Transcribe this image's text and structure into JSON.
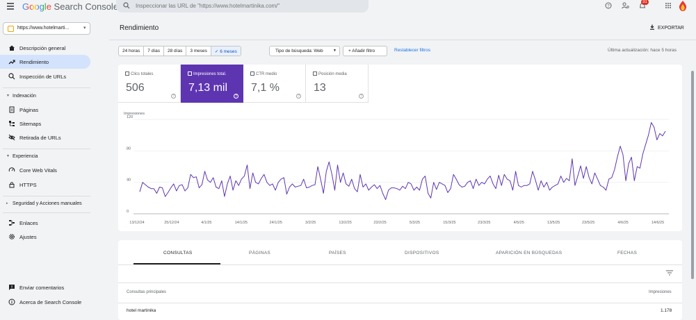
{
  "header": {
    "logo_google": "Google",
    "logo_product": "Search Console",
    "search_placeholder": "Inspeccionar las URL de \"https://www.hotelmartinika.com/\"",
    "notification_count": "31"
  },
  "sidebar": {
    "property": "https://www.hotelmarti...",
    "items": [
      {
        "label": "Descripción general",
        "icon": "home-icon"
      },
      {
        "label": "Rendimiento",
        "icon": "trending-up-icon"
      },
      {
        "label": "Inspección de URLs",
        "icon": "search-icon"
      }
    ],
    "sections": [
      {
        "label": "Indexación",
        "items": [
          {
            "label": "Páginas",
            "icon": "pages-icon"
          },
          {
            "label": "Sitemaps",
            "icon": "sitemap-icon"
          },
          {
            "label": "Retirada de URLs",
            "icon": "eye-off-icon"
          }
        ]
      },
      {
        "label": "Experiencia",
        "items": [
          {
            "label": "Core Web Vitals",
            "icon": "gauge-icon"
          },
          {
            "label": "HTTPS",
            "icon": "lock-icon"
          }
        ]
      },
      {
        "label": "Seguridad y Acciones manuales",
        "items": []
      }
    ],
    "links": [
      "Enlaces",
      "Ajustes"
    ],
    "footer": [
      "Enviar comentarios",
      "Acerca de Search Console"
    ]
  },
  "main": {
    "title": "Rendimiento",
    "export_label": "EXPORTAR",
    "date_ranges": [
      "24 horas",
      "7 días",
      "28 días",
      "3 meses",
      "6 meses"
    ],
    "selected_range": "6 meses",
    "search_type": "Tipo de búsqueda: Web",
    "add_filter": "Añadir filtro",
    "reset_filters": "Restablecer filtros",
    "last_update": "Última actualización: hace 5 horas"
  },
  "metrics": [
    {
      "label": "Clics totales",
      "value": "506",
      "selected": false
    },
    {
      "label": "Impresiones total.",
      "value": "7,13 mil",
      "selected": true
    },
    {
      "label": "CTR medio",
      "value": "7,1 %",
      "selected": false
    },
    {
      "label": "Posición media",
      "value": "13",
      "selected": false
    }
  ],
  "chart_data": {
    "type": "line",
    "title": "",
    "ylabel": "Impresiones",
    "xlabel": "",
    "ylim": [
      0,
      120
    ],
    "yticks": [
      0,
      40,
      80,
      120
    ],
    "xticks": [
      "13/12/24",
      "25/12/24",
      "4/1/25",
      "14/1/25",
      "24/1/25",
      "3/2/25",
      "13/2/25",
      "23/2/25",
      "5/3/25",
      "15/3/25",
      "23/3/25",
      "4/5/25",
      "13/5/25",
      "23/5/25",
      "4/6/25",
      "14/6/25"
    ],
    "color": "#5e35b1",
    "series": [
      {
        "values": [
          28,
          40,
          37,
          34,
          32,
          32,
          26,
          34,
          33,
          22,
          27,
          33,
          38,
          29,
          36,
          37,
          29,
          33,
          50,
          46,
          47,
          33,
          37,
          54,
          43,
          40,
          46,
          34,
          32,
          42,
          22,
          38,
          48,
          30,
          42,
          36,
          44,
          48,
          62,
          32,
          52,
          40,
          38,
          45,
          50,
          40,
          36,
          38,
          30,
          40,
          44,
          46,
          25,
          34,
          38,
          34,
          35,
          36,
          44,
          33,
          34,
          36,
          37,
          60,
          44,
          26,
          54,
          66,
          50,
          30,
          62,
          40,
          52,
          38,
          35,
          44,
          32,
          28,
          50,
          34,
          38,
          30,
          34,
          37,
          32,
          36,
          26,
          18,
          30,
          33,
          33,
          32,
          30,
          35,
          32,
          40,
          38,
          30,
          34,
          30,
          44,
          48,
          26,
          20,
          40,
          31,
          40,
          38,
          36,
          27,
          32,
          50,
          44,
          37,
          34,
          35,
          40,
          42,
          32,
          44,
          36,
          40,
          38,
          44,
          48,
          38,
          32,
          49,
          36,
          50,
          44,
          42,
          30,
          54,
          36,
          34,
          36,
          36,
          38,
          54,
          43,
          30,
          42,
          34,
          40,
          30,
          34,
          36,
          38,
          48,
          40,
          45,
          42,
          70,
          36,
          48,
          61,
          45,
          60,
          46,
          38,
          52,
          44,
          36,
          34,
          30,
          44,
          46,
          56,
          72,
          86,
          75,
          42,
          64,
          72,
          42,
          60,
          58,
          76,
          88,
          100,
          116,
          110,
          94,
          102,
          99,
          105
        ]
      }
    ]
  },
  "tabs": [
    "CONSULTAS",
    "PÁGINAS",
    "PAÍSES",
    "DISPOSITIVOS",
    "APARICIÓN EN BÚSQUEDAS",
    "FECHAS"
  ],
  "table": {
    "col_query": "Consultas principales",
    "col_impressions": "Impresiones",
    "rows": [
      {
        "query": "hotel martinika",
        "impressions": "1.178"
      }
    ]
  }
}
